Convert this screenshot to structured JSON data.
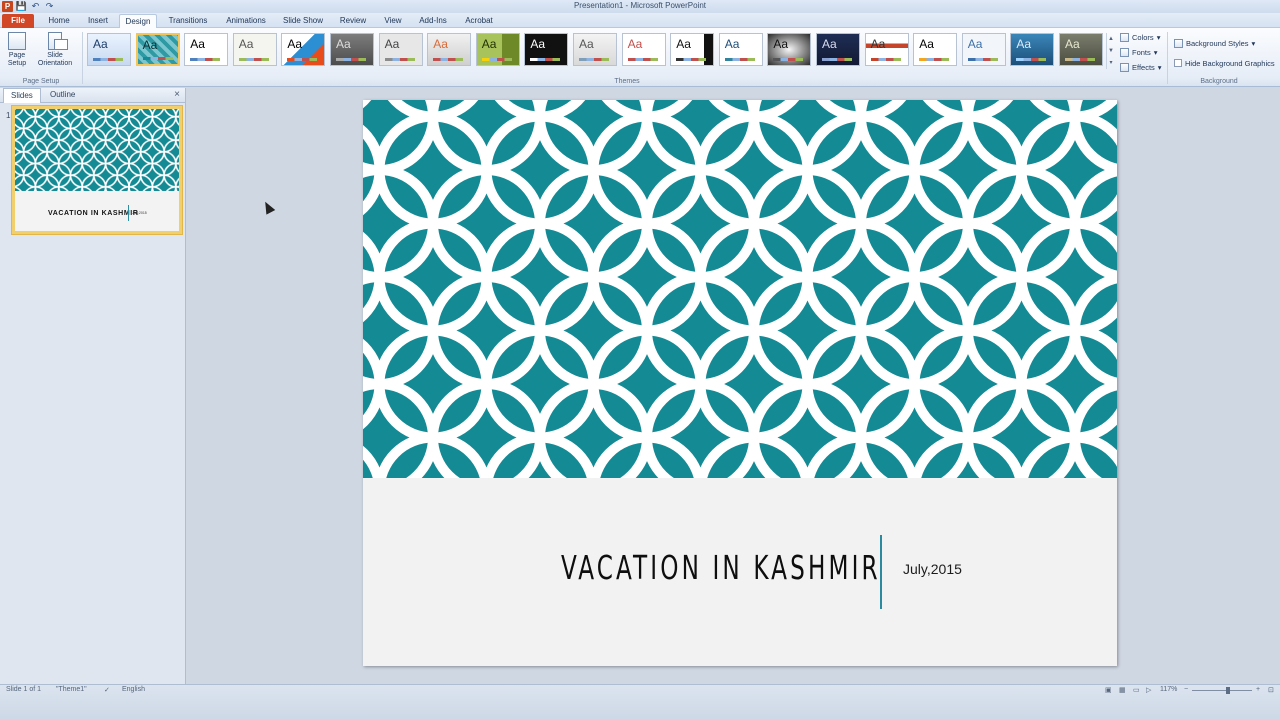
{
  "window": {
    "title": "Presentation1 - Microsoft PowerPoint",
    "app_icon_letter": "P"
  },
  "quick_access": {
    "save_glyph": "💾",
    "undo_glyph": "↶",
    "redo_glyph": "↷"
  },
  "tabs": [
    {
      "label": "File"
    },
    {
      "label": "Home"
    },
    {
      "label": "Insert"
    },
    {
      "label": "Design"
    },
    {
      "label": "Transitions"
    },
    {
      "label": "Animations"
    },
    {
      "label": "Slide Show"
    },
    {
      "label": "Review"
    },
    {
      "label": "View"
    },
    {
      "label": "Add-Ins"
    },
    {
      "label": "Acrobat"
    }
  ],
  "ribbon": {
    "page_setup": {
      "page_setup_label": "Page Setup",
      "slide_orientation_label": "Slide Orientation",
      "group_label": "Page Setup"
    },
    "themes": {
      "group_label": "Themes",
      "aa_text": "Aa",
      "count": 21,
      "selected_index": 1
    },
    "theme_commands": {
      "colors": "Colors",
      "fonts": "Fonts",
      "effects": "Effects"
    },
    "background": {
      "styles": "Background Styles",
      "hide_graphics": "Hide Background Graphics",
      "group_label": "Background"
    }
  },
  "left_panel": {
    "tab_slides": "Slides",
    "tab_outline": "Outline",
    "close_glyph": "×",
    "slide_number": "1"
  },
  "slide": {
    "title": "VACATION IN KASHMIR",
    "date": "July,2015",
    "accent_color": "#138a94"
  },
  "statusbar": {
    "slide_info": "Slide 1 of 1",
    "theme_name": "\"Theme1\"",
    "language": "English",
    "zoom": "117%"
  }
}
